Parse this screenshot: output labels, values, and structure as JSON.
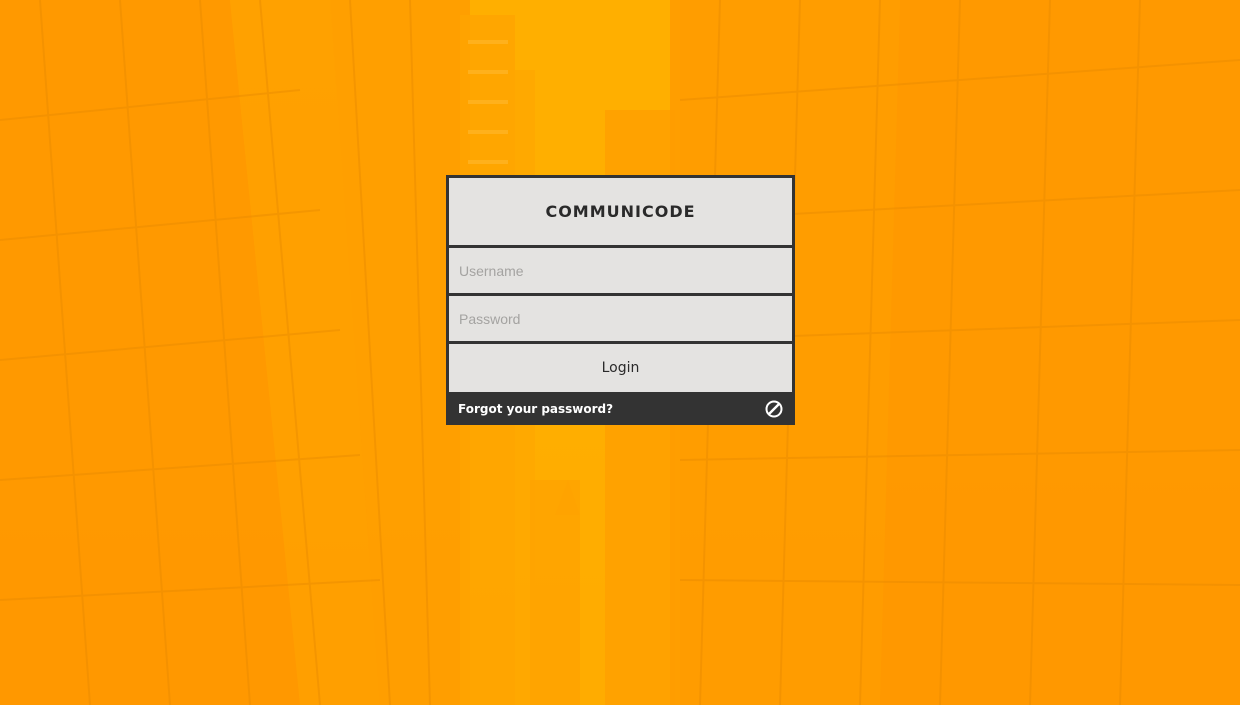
{
  "app": {
    "title": "COMMUNICODE"
  },
  "form": {
    "username_placeholder": "Username",
    "password_placeholder": "Password",
    "login_label": "Login"
  },
  "footer": {
    "forgot_label": "Forgot your password?",
    "icon": "ban-icon"
  },
  "colors": {
    "background": "#ffa200",
    "panel": "#e4e3e1",
    "border": "#333333",
    "footer_text": "#ffffff"
  }
}
